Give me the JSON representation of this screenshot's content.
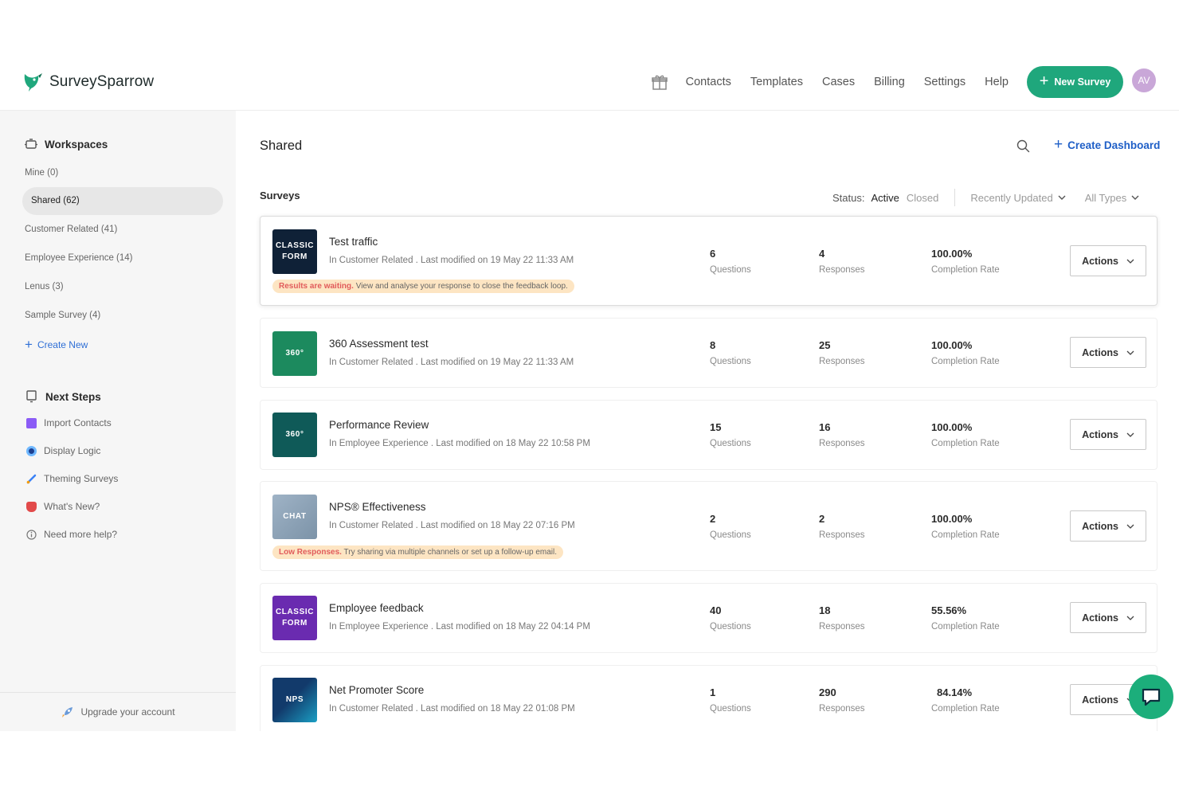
{
  "header": {
    "brand": "SurveySparrow",
    "nav": [
      "Contacts",
      "Templates",
      "Cases",
      "Billing",
      "Settings",
      "Help"
    ],
    "new_survey_label": "New Survey",
    "avatar_initials": "AV",
    "accent_color": "#1fa77c"
  },
  "sidebar": {
    "workspaces_heading": "Workspaces",
    "workspaces": [
      {
        "label": "Mine (0)"
      },
      {
        "label": "Shared (62)"
      },
      {
        "label": "Customer Related (41)"
      },
      {
        "label": "Employee Experience (14)"
      },
      {
        "label": "Lenus (3)"
      },
      {
        "label": "Sample Survey (4)"
      }
    ],
    "create_new_label": "Create New",
    "next_steps_heading": "Next Steps",
    "next_steps": [
      {
        "label": "Import Contacts",
        "icon": "contacts-icon"
      },
      {
        "label": "Display Logic",
        "icon": "logic-icon"
      },
      {
        "label": "Theming Surveys",
        "icon": "brush-icon"
      },
      {
        "label": "What's New?",
        "icon": "news-icon"
      },
      {
        "label": "Need more help?",
        "icon": "info-icon"
      }
    ],
    "upgrade_label": "Upgrade your account"
  },
  "main": {
    "title": "Shared",
    "create_dashboard_label": "Create Dashboard",
    "surveys_label": "Surveys",
    "status_label": "Status:",
    "status_active": "Active",
    "status_closed": "Closed",
    "sort_label": "Recently Updated",
    "type_label": "All Types"
  },
  "surveys": [
    {
      "title": "Test traffic",
      "meta": "In Customer Related . Last modified on 19 May 22 11:33 AM",
      "thumb": [
        "CLASSIC",
        "FORM"
      ],
      "thumb_color": "#0f2137",
      "questions": "6",
      "responses": "4",
      "completion": "100.00%",
      "banner_highlight": "Results are waiting.",
      "banner_text": " View and analyse your response to close the feedback loop."
    },
    {
      "title": "360 Assessment test",
      "meta": "In Customer Related . Last modified on 19 May 22 11:33 AM",
      "thumb": [
        "360°"
      ],
      "thumb_color": "#1c8a5e",
      "questions": "8",
      "responses": "25",
      "completion": "100.00%"
    },
    {
      "title": "Performance Review",
      "meta": "In Employee Experience . Last modified on 18 May 22 10:58 PM",
      "thumb": [
        "360°"
      ],
      "thumb_color": "#0f5a58",
      "questions": "15",
      "responses": "16",
      "completion": "100.00%"
    },
    {
      "title": "NPS® Effectiveness",
      "meta": "In Customer Related . Last modified on 18 May 22 07:16 PM",
      "thumb": [
        "CHAT"
      ],
      "thumb_color": "#8aa1b5",
      "questions": "2",
      "responses": "2",
      "completion": "100.00%",
      "banner_highlight": "Low Responses.",
      "banner_text": " Try sharing via multiple channels or set up a follow-up email."
    },
    {
      "title": "Employee feedback",
      "meta": "In Employee Experience . Last modified on 18 May 22 04:14 PM",
      "thumb": [
        "CLASSIC",
        "FORM"
      ],
      "thumb_color": "#6a2bb0",
      "questions": "40",
      "responses": "18",
      "completion": "55.56%"
    },
    {
      "title": "Net Promoter Score",
      "meta": "In Customer Related . Last modified on 18 May 22 01:08 PM",
      "thumb": [
        "NPS"
      ],
      "thumb_color": "#1b7fa8",
      "questions": "1",
      "responses": "290",
      "completion": "84.14%"
    }
  ],
  "labels": {
    "questions": "Questions",
    "responses": "Responses",
    "completion": "Completion Rate",
    "actions": "Actions"
  }
}
